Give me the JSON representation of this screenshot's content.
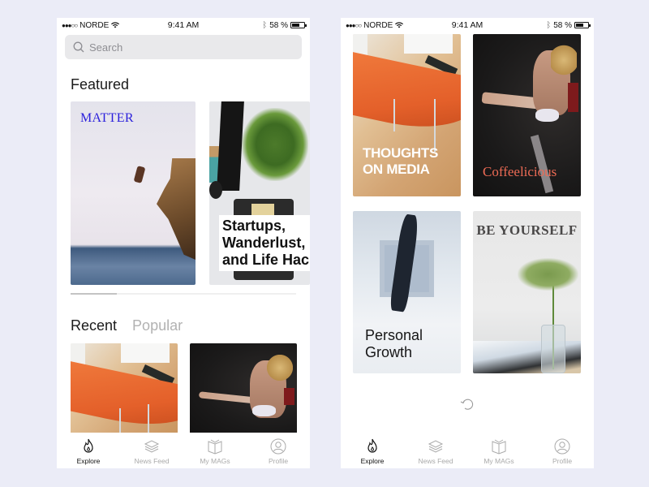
{
  "colors": {
    "background": "#ebecf7",
    "accent_matter": "#2a1fdb",
    "accent_coffee": "#ee6b55",
    "inactive": "#aaaaaa"
  },
  "status_bar": {
    "carrier": "NORDE",
    "signal_icon": "signal-dots-icon",
    "wifi_icon": "wifi-icon",
    "time": "9:41 AM",
    "bluetooth_icon": "bluetooth-icon",
    "battery_percent": "58 %",
    "battery_level": 0.58
  },
  "left_screen": {
    "search": {
      "placeholder": "Search",
      "value": ""
    },
    "featured": {
      "title": "Featured",
      "cards": [
        {
          "title": "MATTER"
        },
        {
          "title_lines": [
            "Startups,",
            "Wanderlust,",
            "and Life Hack"
          ]
        }
      ],
      "scroll_position": 0.2
    },
    "tabs": [
      {
        "label": "Recent",
        "active": true
      },
      {
        "label": "Popular",
        "active": false
      }
    ]
  },
  "right_screen": {
    "cards": [
      {
        "title_lines": [
          "THOUGHTS",
          "ON MEDIA"
        ]
      },
      {
        "title": "Coffeelicious"
      },
      {
        "title_lines": [
          "Personal",
          "Growth"
        ]
      },
      {
        "title": "BE YOURSELF"
      }
    ],
    "refresh_icon": "refresh-icon"
  },
  "tabbar": {
    "items": [
      {
        "label": "Explore",
        "icon": "flame-icon",
        "active": true
      },
      {
        "label": "News Feed",
        "icon": "layers-icon",
        "active": false
      },
      {
        "label": "My MAGs",
        "icon": "book-icon",
        "active": false
      },
      {
        "label": "Profile",
        "icon": "profile-icon",
        "active": false
      }
    ]
  }
}
